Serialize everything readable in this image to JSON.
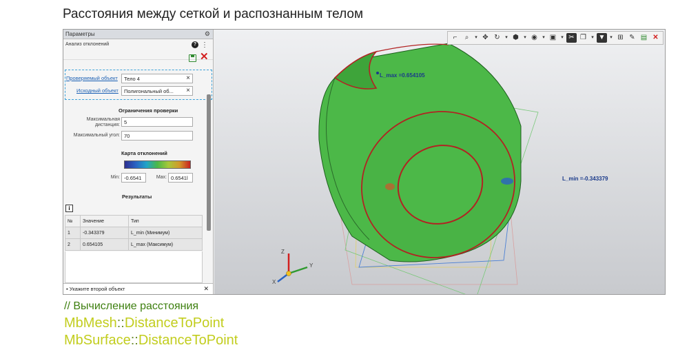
{
  "title": "Расстояния между сеткой и распознанным телом",
  "panel": {
    "header": "Параметры",
    "subheader": "Анализ отклонений",
    "checked_object_label": "Проверяемый объект",
    "checked_object_value": "Тело 4",
    "source_object_label": "Исходный объект",
    "source_object_value": "Полигональный об...",
    "limits_title": "Ограничения проверки",
    "max_distance_label_1": "Максимальная",
    "max_distance_label_2": "дистанция:",
    "max_distance_value": "5",
    "max_angle_label": "Максимальный угол:",
    "max_angle_value": "70",
    "map_title": "Карта отклонений",
    "min_label": "Min:",
    "min_value": "-0.6541",
    "max_label": "Max:",
    "max_value": "0.6541l",
    "results_title": "Результаты",
    "table": {
      "headers": [
        "№",
        "Значение",
        "Тип"
      ],
      "rows": [
        [
          "1",
          "-0.343379",
          "L_min (Минимум)"
        ],
        [
          "2",
          "0.654105",
          "L_max (Максимум)"
        ]
      ]
    },
    "status": "Укажите второй объект"
  },
  "viewport": {
    "lmax_label": "L_max =0.654105",
    "lmin_label": "L_min =-0.343379",
    "axis_x": "X",
    "axis_y": "Y",
    "axis_z": "Z"
  },
  "code": {
    "comment": "// Вычисление расстояния",
    "line1_class": "MbMesh",
    "line1_sep": "::",
    "line1_method": "DistanceToPoint",
    "line2_class": "MbSurface",
    "line2_sep": "::",
    "line2_method": "DistanceToPoint"
  },
  "colors": {
    "body_green": "#4cb848",
    "edge_red": "#b22222",
    "code_comment": "#3d7f0f",
    "code_text": "#c2cd1e"
  }
}
